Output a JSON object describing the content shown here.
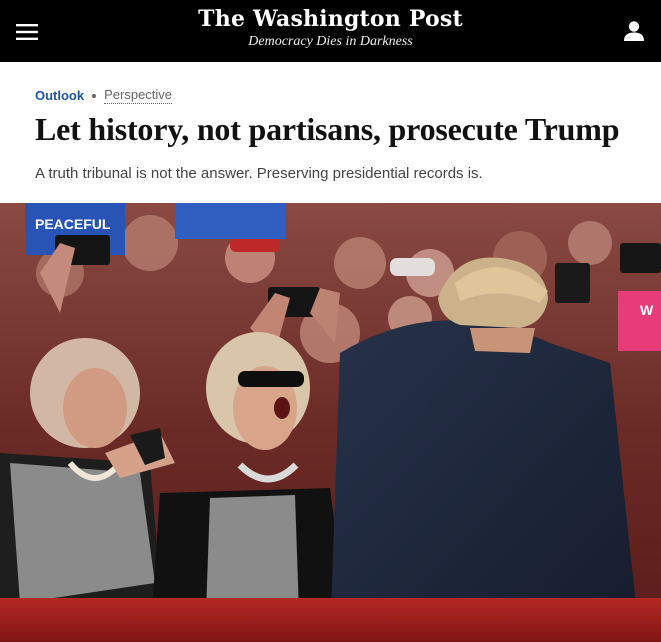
{
  "masthead": {
    "title": "The Washington Post",
    "tagline": "Democracy Dies in Darkness"
  },
  "icons": {
    "menu": "hamburger-menu-icon",
    "account": "user-account-icon"
  },
  "article": {
    "section": "Outlook",
    "label": "Perspective",
    "headline": "Let history, not partisans, prosecute Trump",
    "subheadline": "A truth tribunal is not the answer. Preserving presidential records is."
  },
  "photo": {
    "sign_text_left": "PEACEFUL",
    "sign_text_right": "W"
  },
  "colors": {
    "topbar": "#000000",
    "section_link": "#1955a5",
    "headline": "#111111"
  }
}
